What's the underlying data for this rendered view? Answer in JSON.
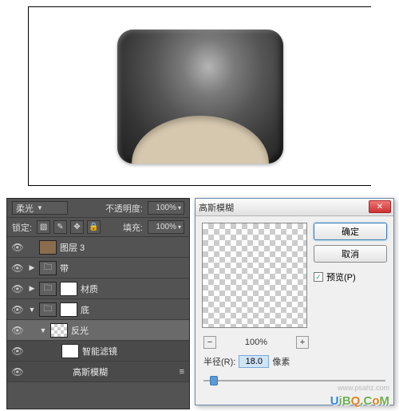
{
  "layersPanel": {
    "blendModeLabel": "柔光",
    "opacityLabel": "不透明度:",
    "opacityValue": "100%",
    "lockLabel": "锁定:",
    "fillLabel": "填充:",
    "fillValue": "100%",
    "layers": [
      {
        "name": "图层 3",
        "thumb": "img"
      },
      {
        "name": "带",
        "thumb": "folder"
      },
      {
        "name": "材质",
        "thumb": "white",
        "mask": true
      },
      {
        "name": "底",
        "thumb": "white",
        "mask": true
      },
      {
        "name": "反光",
        "thumb": "check",
        "selected": true
      },
      {
        "name": "智能滤镜",
        "thumb": "white",
        "sub": true
      },
      {
        "name": "高斯模糊",
        "sub": true,
        "text": true
      }
    ]
  },
  "dialog": {
    "title": "高斯模糊",
    "ok": "确定",
    "cancel": "取消",
    "previewCheck": "预览(P)",
    "zoom": "100%",
    "radiusLabel": "半径(R):",
    "radiusValue": "18.0",
    "radiusUnit": "像素"
  },
  "watermark2": "www.psahz.com",
  "watermark": "UiBQ.CoM"
}
